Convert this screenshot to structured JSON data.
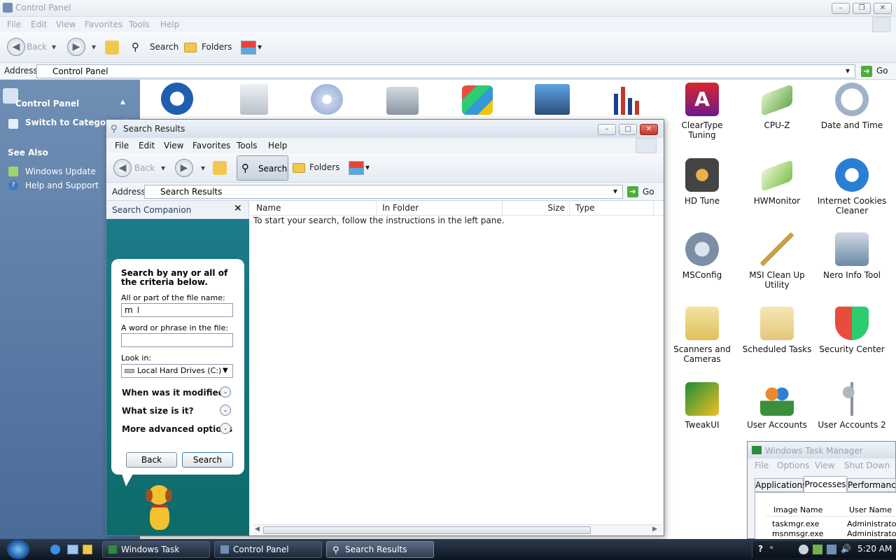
{
  "control_panel": {
    "title": "Control Panel",
    "menu": [
      "File",
      "Edit",
      "View",
      "Favorites",
      "Tools",
      "Help"
    ],
    "toolbar": {
      "back": "Back",
      "search": "Search",
      "folders": "Folders"
    },
    "address_label": "Address",
    "address_value": "Control Panel",
    "go": "Go",
    "left_pane": {
      "header": "Control Panel",
      "switch_view": "Switch to Category Vi",
      "see_also": "See Also",
      "links": [
        "Windows Update",
        "Help and Support"
      ]
    },
    "icons": [
      {
        "label": "ClearType Tuning",
        "icon": "cleartype-icon",
        "color": "#d8262e"
      },
      {
        "label": "CPU-Z",
        "icon": "cpu-icon",
        "color": "#6aa84f"
      },
      {
        "label": "Date and Time",
        "icon": "clock-icon",
        "color": "#9fb3c8"
      },
      {
        "label": "HD Tune",
        "icon": "harddisk-icon",
        "color": "#555555"
      },
      {
        "label": "HWMonitor",
        "icon": "monitor-chip-icon",
        "color": "#7fbf4a"
      },
      {
        "label": "Internet Cookies Cleaner",
        "icon": "internet-explorer-icon",
        "color": "#2a7fd4"
      },
      {
        "label": "MSConfig",
        "icon": "wrench-gear-icon",
        "color": "#c0392b"
      },
      {
        "label": "MSI Clean Up Utility",
        "icon": "broom-icon",
        "color": "#c9a04a"
      },
      {
        "label": "Nero Info Tool",
        "icon": "nero-drive-icon",
        "color": "#6c8aa6"
      },
      {
        "label": "Scanners and Cameras",
        "icon": "scanner-camera-icon",
        "color": "#e0c15a"
      },
      {
        "label": "Scheduled Tasks",
        "icon": "scheduled-folder-icon",
        "color": "#e5c77a"
      },
      {
        "label": "Security Center",
        "icon": "security-shield-icon",
        "color": "#2f7fd6"
      },
      {
        "label": "TweakUI",
        "icon": "tweakui-icon",
        "color": "#f0c020"
      },
      {
        "label": "User Accounts",
        "icon": "users-icon",
        "color": "#e8892b"
      },
      {
        "label": "User Accounts 2",
        "icon": "keys-icon",
        "color": "#b0b7bf"
      }
    ],
    "top_row_icons": [
      "accessibility-icon",
      "add-remove-programs-icon",
      "cd-icon",
      "admin-tools-icon",
      "windows-flag-icon",
      "network-transfer-icon",
      "chart-bars-icon"
    ]
  },
  "search_window": {
    "title": "Search Results",
    "menu": [
      "File",
      "Edit",
      "View",
      "Favorites",
      "Tools",
      "Help"
    ],
    "toolbar": {
      "back": "Back",
      "search": "Search",
      "folders": "Folders"
    },
    "address_label": "Address",
    "address_value": "Search Results",
    "go": "Go",
    "companion_title": "Search Companion",
    "companion": {
      "heading": "Search by any or all of the criteria below.",
      "filename_label": "All or part of the file name:",
      "filename_value": "m",
      "phrase_label": "A word or phrase in the file:",
      "phrase_value": "",
      "lookin_label": "Look in:",
      "lookin_value": "Local Hard Drives (C:)",
      "options": [
        "When was it modified?",
        "What size is it?",
        "More advanced options"
      ],
      "back_button": "Back",
      "search_button": "Search"
    },
    "columns": [
      "Name",
      "In Folder",
      "Size",
      "Type"
    ],
    "empty_message": "To start your search, follow the instructions in the left pane."
  },
  "task_manager": {
    "title": "Windows Task Manager",
    "menu": [
      "File",
      "Options",
      "View",
      "Shut Down"
    ],
    "tabs": [
      "Applications",
      "Processes",
      "Performance"
    ],
    "active_tab": "Processes",
    "columns": [
      "Image Name",
      "User Name"
    ],
    "rows": [
      {
        "image": "taskmgr.exe",
        "user": "Administrator"
      },
      {
        "image": "msnmsgr.exe",
        "user": "Administrator"
      }
    ]
  },
  "taskbar": {
    "buttons": [
      "Windows Task Mana...",
      "Control Panel",
      "Search Results"
    ],
    "active": "Search Results",
    "clock": "5:20 AM"
  }
}
